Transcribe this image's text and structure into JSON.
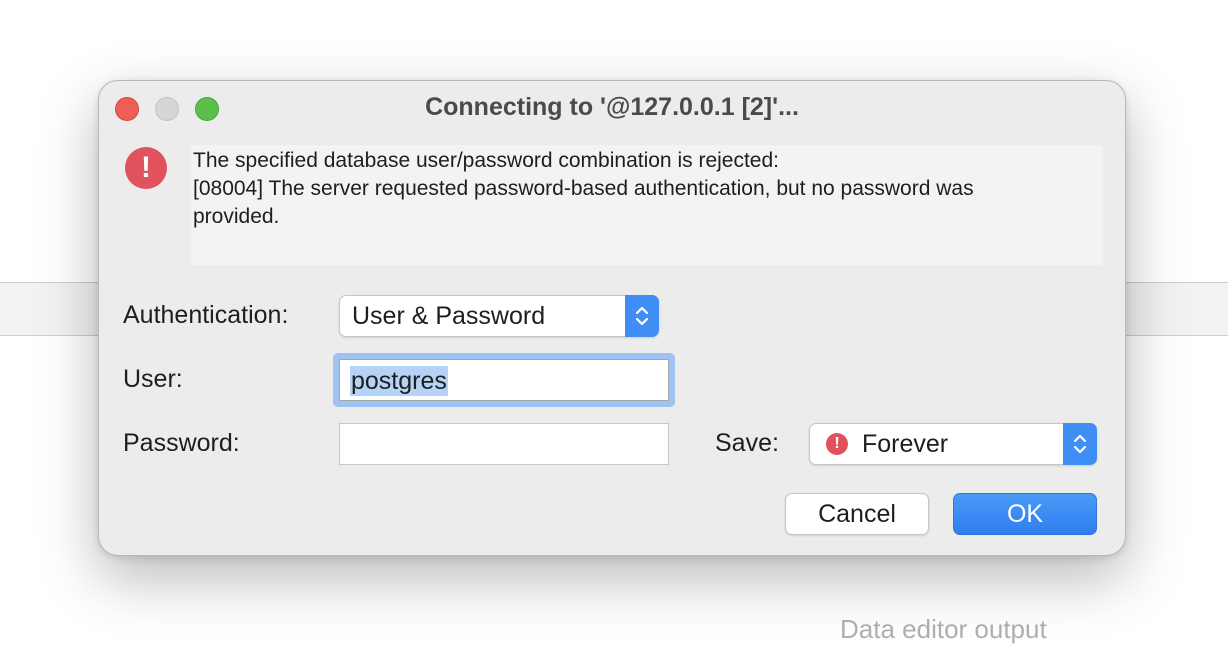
{
  "background": {
    "footer_text": "Data editor output"
  },
  "dialog": {
    "title": "Connecting to '@127.0.0.1 [2]'...",
    "error_icon": "exclamation-circle-icon",
    "error_glyph": "!",
    "message_lines": [
      "The specified database user/password combination is rejected:",
      "[08004] The server requested password-based authentication, but no password was",
      "provided."
    ],
    "authentication": {
      "label": "Authentication:",
      "value": "User & Password"
    },
    "user": {
      "label": "User:",
      "value": "postgres"
    },
    "password": {
      "label": "Password:",
      "value": ""
    },
    "save": {
      "label": "Save:",
      "value": "Forever",
      "icon": "warning-icon",
      "glyph": "!"
    },
    "buttons": {
      "cancel": "Cancel",
      "ok": "OK"
    }
  },
  "colors": {
    "close": "#ee5e57",
    "minimize": "#d6d6d6",
    "zoom": "#5dbf4b",
    "accent": "#3f8ef5",
    "error": "#e0535d"
  }
}
